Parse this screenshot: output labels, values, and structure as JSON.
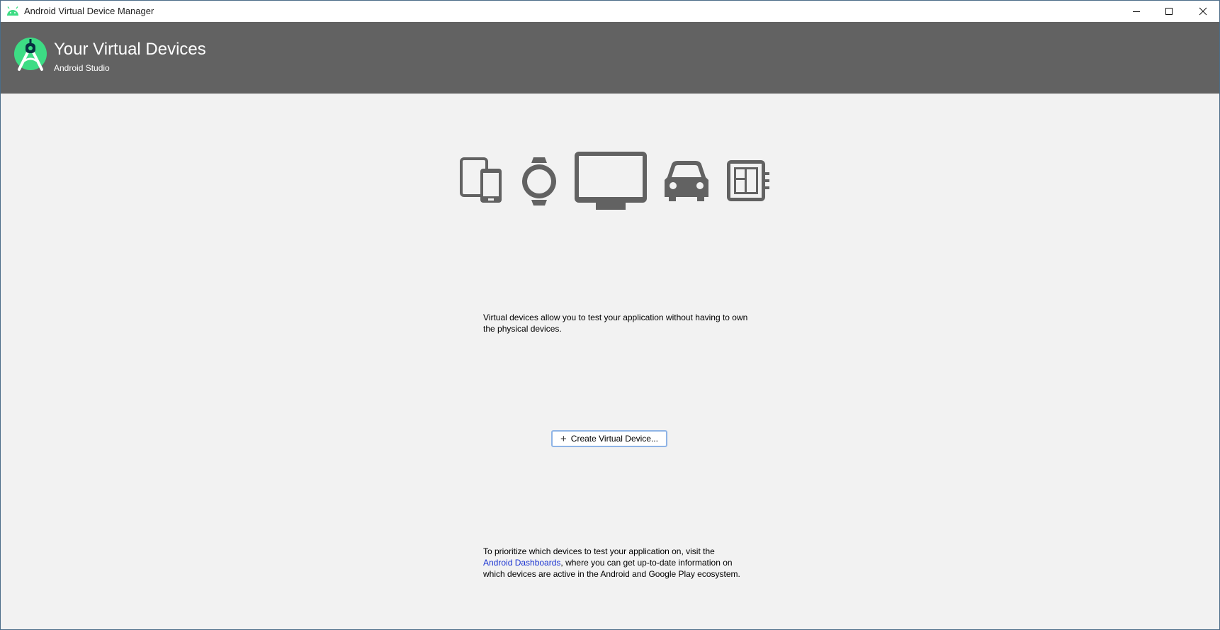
{
  "window": {
    "title": "Android Virtual Device Manager"
  },
  "header": {
    "title": "Your Virtual Devices",
    "subtitle": "Android Studio"
  },
  "icons": {
    "app": "android-icon",
    "logo": "android-studio-logo",
    "devices": [
      "phone-tablet-icon",
      "watch-icon",
      "tv-icon",
      "car-icon",
      "things-board-icon"
    ],
    "min": "minimize-icon",
    "max": "maximize-icon",
    "close": "close-icon",
    "plus": "plus-icon"
  },
  "colors": {
    "header_bg": "#626262",
    "android_green": "#3ddc84",
    "link": "#1a33d1",
    "button_border": "#8fb4e6"
  },
  "main": {
    "description": "Virtual devices allow you to test your application without having to own the physical devices.",
    "create_button": "Create Virtual Device...",
    "prioritize_before": "To prioritize which devices to test your application on, visit the",
    "dashboards_link": "Android Dashboards",
    "prioritize_after": ", where you can get up-to-date information on which devices are active in the Android and Google Play ecosystem."
  }
}
